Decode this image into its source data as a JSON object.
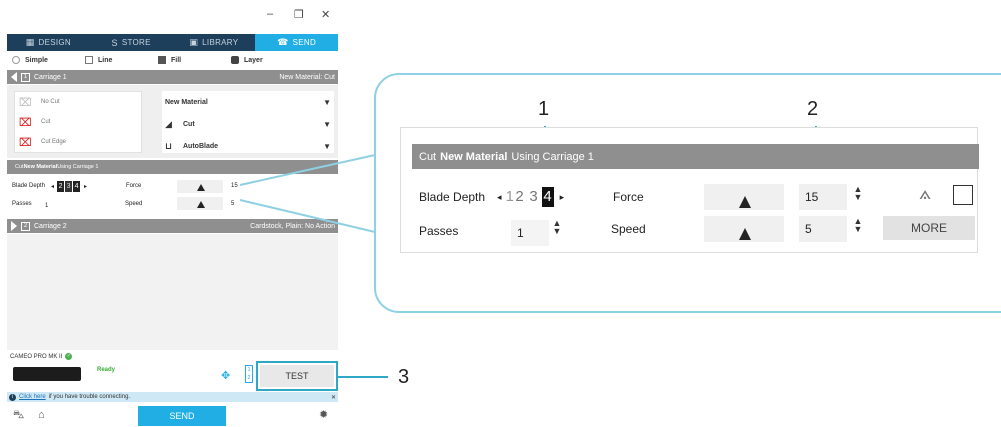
{
  "window": {
    "minimize": "–",
    "restore": "❐",
    "close": "✕"
  },
  "nav_tabs": [
    {
      "label": "DESIGN",
      "icon": "▦"
    },
    {
      "label": "STORE",
      "icon": "S"
    },
    {
      "label": "LIBRARY",
      "icon": "▣"
    },
    {
      "label": "SEND",
      "icon": "☎"
    }
  ],
  "modes": [
    "Simple",
    "Line",
    "Fill",
    "Layer"
  ],
  "carriage1": {
    "num": "1",
    "label": "Carriage 1",
    "right": "New Material: Cut"
  },
  "cut_options": [
    "No Cut",
    "Cut",
    "Cut Edge"
  ],
  "dropdowns": [
    "New Material",
    "Cut",
    "AutoBlade"
  ],
  "cut_header": {
    "prefix": "Cut ",
    "material": "New Material",
    "suffix": " Using Carriage 1"
  },
  "settings": {
    "blade_label": "Blade Depth",
    "blade_digits": [
      "2",
      "3",
      "4"
    ],
    "force_label": "Force",
    "force_value": "15",
    "passes_label": "Passes",
    "passes_value": "1",
    "speed_label": "Speed",
    "speed_value": "5"
  },
  "carriage2": {
    "num": "2",
    "label": "Carriage 2",
    "right": "Cardstock, Plain: No Action"
  },
  "status": {
    "machine_name": "CAMEO PRO MK II",
    "ready": "Ready"
  },
  "test_label": "TEST",
  "info": {
    "link": "Click here",
    "text": " if you have trouble connecting."
  },
  "send_label": "SEND",
  "zoom": {
    "header_prefix": "Cut ",
    "header_material": "New Material",
    "header_suffix": " Using Carriage 1",
    "blade_label": "Blade Depth",
    "blade_digits": [
      "2",
      "3",
      "4"
    ],
    "force_label": "Force",
    "force_value": "15",
    "passes_label": "Passes",
    "passes_value": "1",
    "speed_label": "Speed",
    "speed_value": "5",
    "more_label": "MORE"
  },
  "callouts": [
    "1",
    "2",
    "3"
  ],
  "colors": {
    "accent": "#21aee4",
    "nav": "#1d3f5c",
    "callout": "#2ea8c4",
    "bar": "#8f8f8f"
  }
}
